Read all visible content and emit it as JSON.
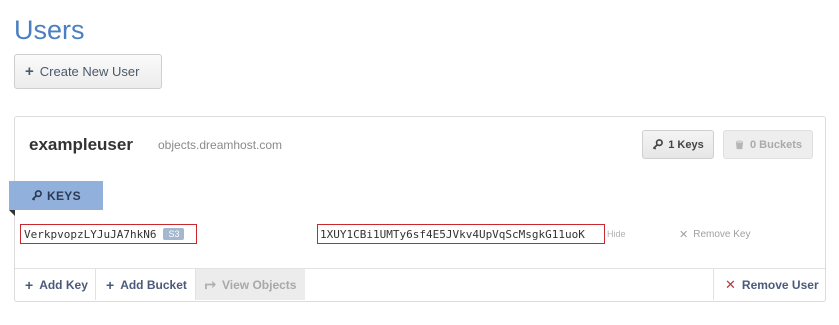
{
  "page": {
    "title": "Users",
    "create_button_label": "Create New User"
  },
  "user": {
    "name": "exampleuser",
    "host": "objects.dreamhost.com",
    "keys_count_label": "1 Keys",
    "buckets_count_label": "0 Buckets"
  },
  "keys_section": {
    "tab_label": "KEYS",
    "access_key": "VerkpvopzLYJuJA7hkN6",
    "access_key_badge": "S3",
    "secret_key": "1XUY1CBi1UMTy6sf4E5JVkv4UpVqScMsgkG11uoK",
    "hide_label": "Hide",
    "remove_key_label": "Remove Key"
  },
  "footer": {
    "add_key_label": "Add Key",
    "add_bucket_label": "Add Bucket",
    "view_objects_label": "View Objects",
    "remove_user_label": "Remove User"
  },
  "colors": {
    "title": "#4a7fc0",
    "keys_tab_bg": "#92b0dc",
    "highlight_border": "#c8282e",
    "remove_red": "#b23b3b"
  }
}
